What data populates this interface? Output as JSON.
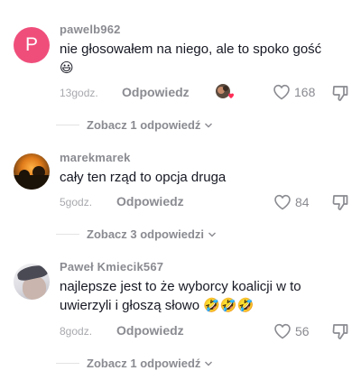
{
  "comments": [
    {
      "username": "pawelb962",
      "avatar_letter": "P",
      "text": "nie głosowałem na niego, ale to spoko gość",
      "emojis": [
        "😃"
      ],
      "time": "13godz.",
      "reply_label": "Odpowiedz",
      "likes": "168",
      "liked_by_creator": true,
      "view_replies": "Zobacz 1 odpowiedź"
    },
    {
      "username": "marekmarek",
      "text": "cały ten rząd to opcja druga",
      "emojis": [],
      "time": "5godz.",
      "reply_label": "Odpowiedz",
      "likes": "84",
      "view_replies": "Zobacz 3 odpowiedzi"
    },
    {
      "username": "Paweł Kmiecik567",
      "text_line1": "najlepsze jest to że wyborcy koalicji w to",
      "text_line2": "uwierzyli i głoszą słowo",
      "emojis": [
        "🤣",
        "🤣",
        "🤣"
      ],
      "time": "8godz.",
      "reply_label": "Odpowiedz",
      "likes": "56",
      "view_replies": "Zobacz 1 odpowiedź"
    }
  ],
  "icons": {
    "like": "heart-outline-icon",
    "dislike": "thumbs-down-outline-icon",
    "chevron": "chevron-down-icon"
  },
  "colors": {
    "username": "#8a8b91",
    "text": "#161823",
    "muted": "#a8a9ae",
    "avatar_p": "#ef4e7b",
    "creator_heart": "#fe2c55"
  }
}
